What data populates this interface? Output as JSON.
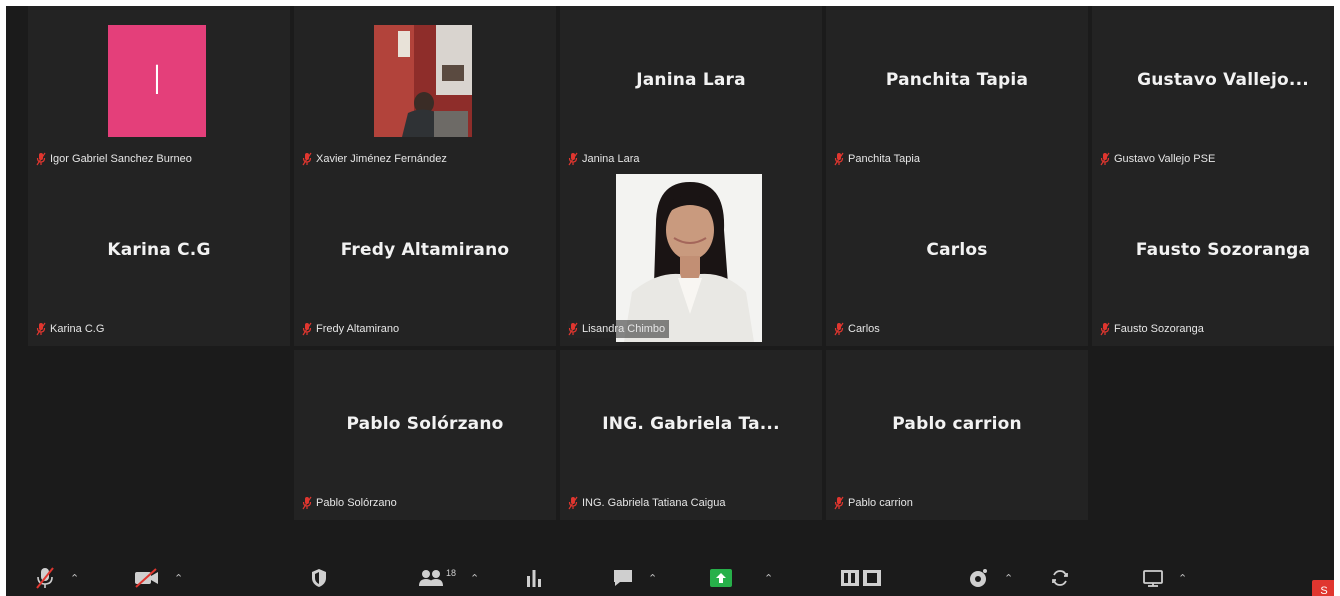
{
  "participants": [
    {
      "label": "Igor Gabriel Sanchez Burneo",
      "avatar_letter": "I",
      "avatar_color": "#e43f7a"
    },
    {
      "label": "Xavier Jiménez Fernández"
    },
    {
      "display": "Janina Lara",
      "label": "Janina Lara"
    },
    {
      "display": "Panchita Tapia",
      "label": "Panchita Tapia"
    },
    {
      "display": "Gustavo Vallejo...",
      "label": "Gustavo Vallejo PSE"
    },
    {
      "display": "Karina C.G",
      "label": "Karina C.G"
    },
    {
      "display": "Fredy Altamirano",
      "label": "Fredy Altamirano"
    },
    {
      "label": "Lisandra Chimbo"
    },
    {
      "display": "Carlos",
      "label": "Carlos"
    },
    {
      "display": "Fausto Sozoranga",
      "label": "Fausto Sozoranga"
    },
    {
      "display": "Pablo Solórzano",
      "label": "Pablo Solórzano"
    },
    {
      "display": "ING. Gabriela Ta...",
      "label": "ING. Gabriela Tatiana Caigua"
    },
    {
      "display": "Pablo carrion",
      "label": "Pablo carrion"
    }
  ],
  "toolbar": {
    "participants_count": "18",
    "end_label": "S"
  },
  "colors": {
    "muted_red": "#e0362f",
    "share_green": "#27b04a"
  }
}
